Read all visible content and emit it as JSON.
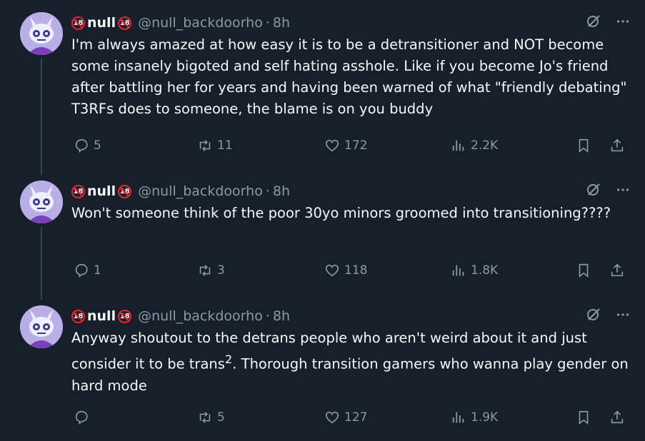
{
  "tweets": [
    {
      "display_name": "null",
      "handle": "@null_backdoorho",
      "separator": "·",
      "time": "8h",
      "text": "I'm always amazed at how easy it is to be a detransitioner and NOT become some insanely bigoted and self hating asshole. Like if you become Jo's friend after battling her for years and having been warned of what \"friendly debating\" T3RFs does to someone, the blame is on you buddy",
      "replies": "5",
      "reposts": "11",
      "likes": "172",
      "views": "2.2K"
    },
    {
      "display_name": "null",
      "handle": "@null_backdoorho",
      "separator": "·",
      "time": "8h",
      "text": "Won't someone think of the poor 30yo minors groomed into transitioning????",
      "replies": "1",
      "reposts": "3",
      "likes": "118",
      "views": "1.8K"
    },
    {
      "display_name": "null",
      "handle": "@null_backdoorho",
      "separator": "·",
      "time": "8h",
      "text_before_sup": "Anyway shoutout to the detrans people who aren't weird about it and just consider it to be trans",
      "sup": "2",
      "text_after_sup": ". Thorough transition gamers who wanna play gender on hard mode",
      "replies": "",
      "reposts": "5",
      "likes": "127",
      "views": "1.9K"
    }
  ],
  "badge_text": "18",
  "colors": {
    "background": "#15202b",
    "text": "#f7f9f9",
    "muted": "#8b98a5",
    "badge": "#f4212e",
    "avatar": "#b9aee6"
  },
  "icons": [
    "reply-icon",
    "repost-icon",
    "like-icon",
    "views-icon",
    "bookmark-icon",
    "share-icon",
    "grok-icon",
    "more-icon",
    "no-18-badge-icon"
  ]
}
